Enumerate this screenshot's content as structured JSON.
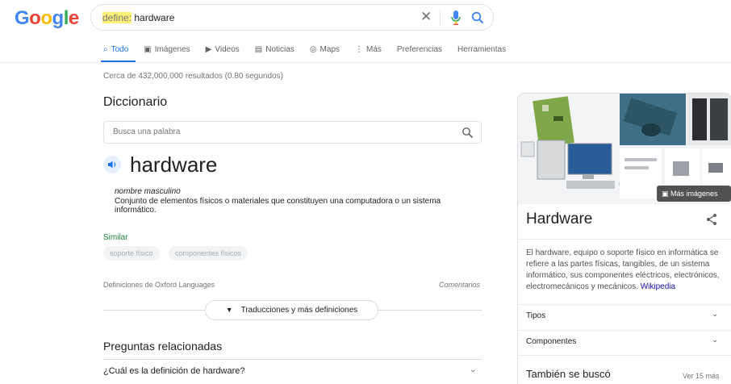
{
  "header": {
    "logo_letters": [
      "G",
      "o",
      "o",
      "g",
      "l",
      "e"
    ],
    "query_operator": "define:",
    "query_text": " hardware",
    "clear_glyph": "✕"
  },
  "tabs": [
    {
      "label": "Todo",
      "icon": "search-icon",
      "active": true
    },
    {
      "label": "Imágenes",
      "icon": "image-icon"
    },
    {
      "label": "Videos",
      "icon": "video-icon"
    },
    {
      "label": "Noticias",
      "icon": "news-icon"
    },
    {
      "label": "Maps",
      "icon": "map-pin-icon"
    },
    {
      "label": "Más",
      "icon": "more-vert-icon"
    },
    {
      "label": "Preferencias",
      "icon": ""
    },
    {
      "label": "Herramientas",
      "icon": ""
    }
  ],
  "stats": "Cerca de 432,000,000 resultados (0.80 segundos)",
  "dictionary": {
    "title": "Diccionario",
    "search_placeholder": "Busca una palabra",
    "word": "hardware",
    "part_of_speech": "nombre masculino",
    "definition": "Conjunto de elementos físicos o materiales que constituyen una computadora o un sistema informático.",
    "similar_label": "Similar",
    "similar": [
      "soporte físico",
      "componentes físicos"
    ],
    "source": "Definiciones de Oxford Languages",
    "feedback": "Comentarios",
    "more_button": "Traducciones y más definiciones"
  },
  "related": {
    "title": "Preguntas relacionadas",
    "questions": [
      "¿Cuál es la definición de hardware?"
    ]
  },
  "knowledge_panel": {
    "more_images": "Más imágenes",
    "title": "Hardware",
    "description": "El hardware, equipo o soporte físico en informática se refiere a las partes físicas, tangibles, de un sistema informático, sus componentes eléctricos, electrónicos, electromecánicos y mecánicos.",
    "source_link": "Wikipedia",
    "rows": [
      "Tipos",
      "Componentes"
    ],
    "also_searched": "También se buscó",
    "see_more": "Ver 15 más"
  },
  "colors": {
    "accent": "#1a73e8",
    "link": "#1a0dab",
    "similar_green": "#188038",
    "highlight": "#fff176"
  }
}
